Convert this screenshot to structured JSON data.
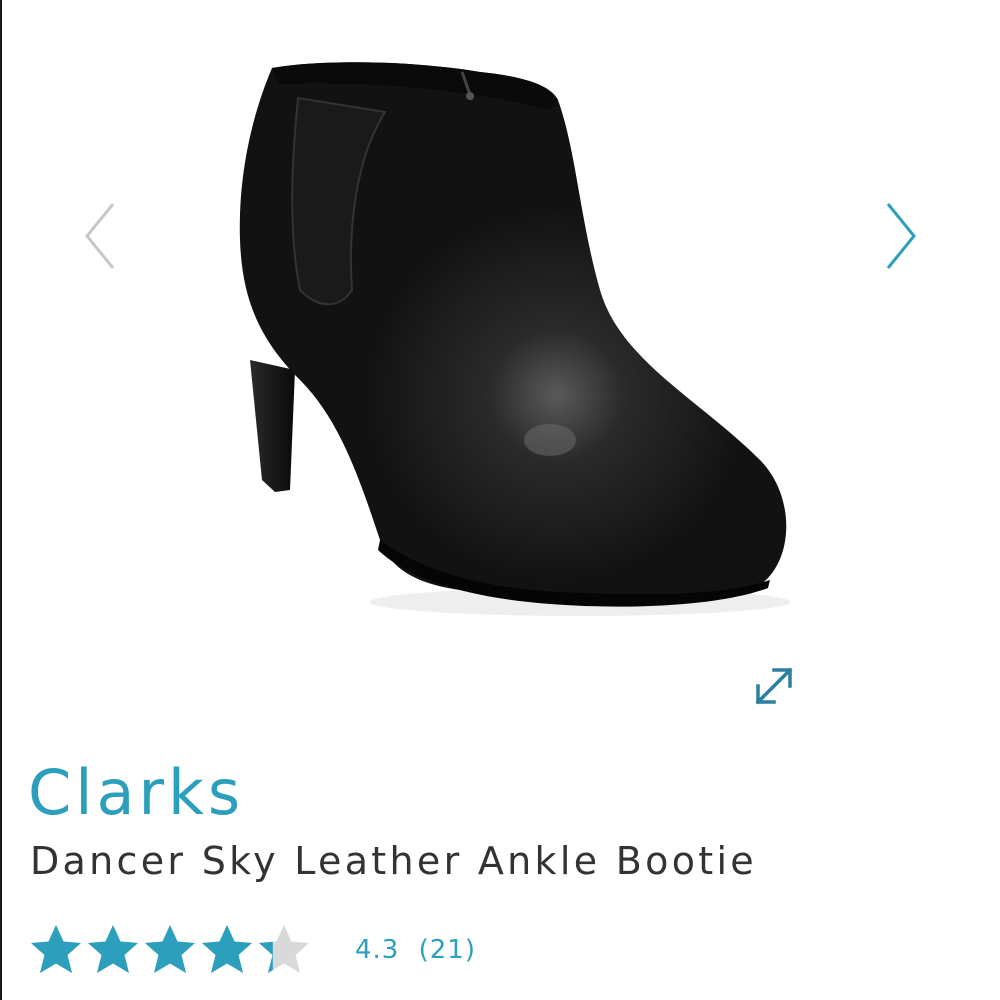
{
  "product": {
    "brand": "Clarks",
    "name": "Dancer Sky Leather Ankle Bootie"
  },
  "rating": {
    "value": "4.3",
    "count": "(21)",
    "stars_filled": 4.3,
    "stars_total": 5
  },
  "gallery": {
    "prev_icon": "chevron-left-icon",
    "next_icon": "chevron-right-icon",
    "expand_icon": "expand-icon"
  },
  "colors": {
    "accent": "#2b9fbc",
    "text": "#333333",
    "star_empty": "#d9d9d9",
    "prev_arrow": "#c8c8c8"
  }
}
